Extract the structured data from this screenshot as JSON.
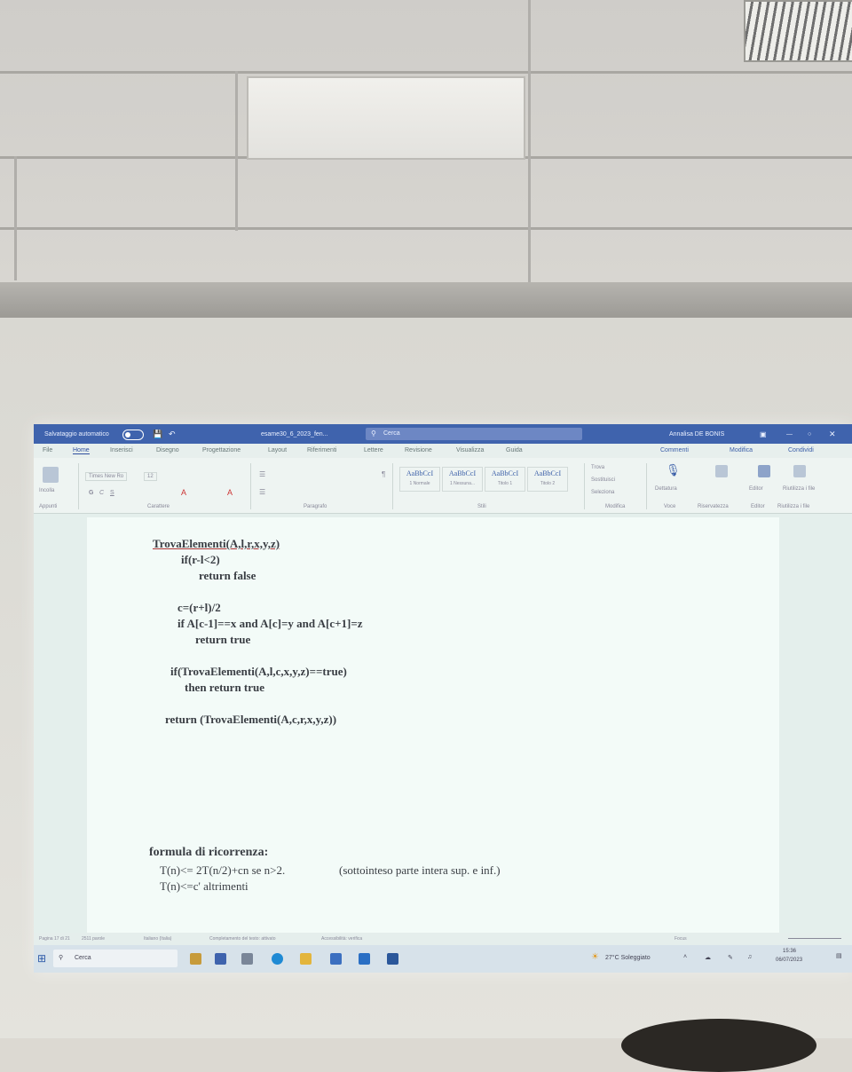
{
  "word": {
    "title_bar": {
      "autosave_label": "Salvataggio automatico",
      "filename": "esame30_6_2023_fen...",
      "search_placeholder": "Cerca",
      "user": "Annalisa DE BONIS"
    },
    "menu_tabs": [
      "File",
      "Home",
      "Inserisci",
      "Disegno",
      "Progettazione",
      "Layout",
      "Riferimenti",
      "Lettere",
      "Revisione",
      "Visualizza",
      "Guida"
    ],
    "right_actions": {
      "comments": "Commenti",
      "edit": "Modifica",
      "share": "Condividi"
    },
    "ribbon": {
      "paste": "Incolla",
      "font_name": "Times New Ro",
      "font_size": "12",
      "style_preview": "AaBbCcI",
      "styles": [
        "1 Normale",
        "1 Nessuna...",
        "Titolo 1",
        "Titolo 2"
      ],
      "find": "Trova",
      "replace": "Sostituisci",
      "select": "Seleziona",
      "dictate": "Dettatura",
      "editor": "Editor",
      "reuse": "Riutilizza i file",
      "groups": [
        "Appunti",
        "Carattere",
        "Paragrafo",
        "Stili",
        "Modifica",
        "Voce",
        "Riservatezza",
        "Editor",
        "Riutilizza i file"
      ]
    },
    "document": {
      "code_lines": [
        "TrovaElementi(A,l,r,x,y,z)",
        "if(r-l<2)",
        "return false",
        "c=(r+l)/2",
        "if A[c-1]==x and A[c]=y and A[c+1]=z",
        "return true",
        "if(TrovaElementi(A,l,c,x,y,z)==true)",
        "then return true",
        "return (TrovaElementi(A,c,r,x,y,z))"
      ],
      "formula_title": "formula di ricorrenza:",
      "formula_line1": "T(n)<= 2T(n/2)+cn se n>2.",
      "formula_note": "(sottointeso parte intera sup. e inf.)",
      "formula_line2": "T(n)<=c' altrimenti"
    },
    "status_bar": {
      "page": "Pagina 17 di 21",
      "words": "2511 parole",
      "language": "Italiano (Italia)",
      "text_prediction": "Completamento del testo: attivato",
      "accessibility": "Accessibilità: verifica",
      "focus": "Focus"
    },
    "taskbar": {
      "search": "Cerca",
      "weather": "27°C Soleggiato",
      "time": "15:36",
      "date": "06/07/2023"
    }
  }
}
